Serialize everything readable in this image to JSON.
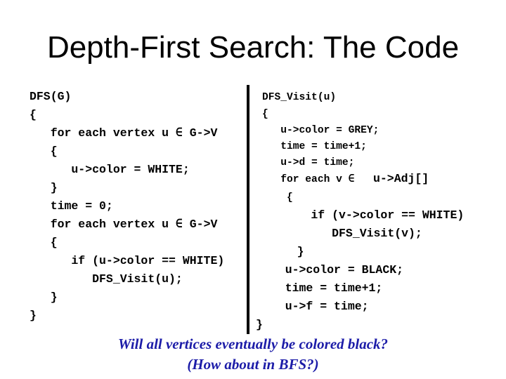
{
  "slide": {
    "title": "Depth-First Search: The Code",
    "left_code": [
      "DFS(G)",
      "{",
      "   for each vertex u ∈ G->V",
      "   {",
      "      u->color = WHITE;",
      "   }",
      "   time = 0;",
      "   for each vertex u ∈ G->V",
      "   {",
      "      if (u->color == WHITE)",
      "         DFS_Visit(u);",
      "   }",
      "}"
    ],
    "right_code": [
      "DFS_Visit(u)",
      "{",
      "   u->color = GREY;",
      "   time = time+1;",
      "   u->d = time;",
      "   for each v ∈ ",
      "u->Adj[]",
      "    {",
      "      if (v->color == WHITE)",
      "         DFS_Visit(v);",
      "    }",
      "   u->color = BLACK;",
      "   time = time+1;",
      "   u->f = time;",
      "}"
    ],
    "question_line1": "Will all vertices eventually be colored black?",
    "question_line2": "(How about in BFS?)",
    "question_color": "#1c1ca8"
  }
}
